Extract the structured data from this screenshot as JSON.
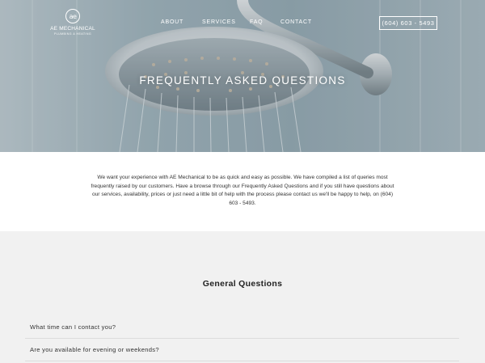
{
  "header": {
    "logo_monogram": "ae",
    "logo_name": "AE MECHANICAL",
    "logo_tagline": "PLUMBING & HEATING",
    "nav": [
      {
        "label": "ABOUT"
      },
      {
        "label": "SERVICES"
      },
      {
        "label": "FAQ"
      },
      {
        "label": "CONTACT"
      }
    ],
    "phone": "(604) 603 - 5493"
  },
  "hero": {
    "title": "FREQUENTLY ASKED QUESTIONS"
  },
  "intro": {
    "text": "We want your experience with AE Mechanical to be as quick and easy as possible. We have compiled a list of queries most frequently raised by our customers.  Have a browse through our Frequently Asked Questions and if you still have questions about our services, availability, prices or just need a little bit of help with the process please contact us we'll be happy to help, on (604) 603 - 5493."
  },
  "faq": {
    "heading": "General Questions",
    "items": [
      {
        "question": "What time can I contact you?"
      },
      {
        "question": "Are you available for evening or weekends?"
      }
    ]
  },
  "colors": {
    "hero_tint": "#9fb2bb",
    "faq_bg": "#f1f1f1",
    "text": "#333333"
  }
}
